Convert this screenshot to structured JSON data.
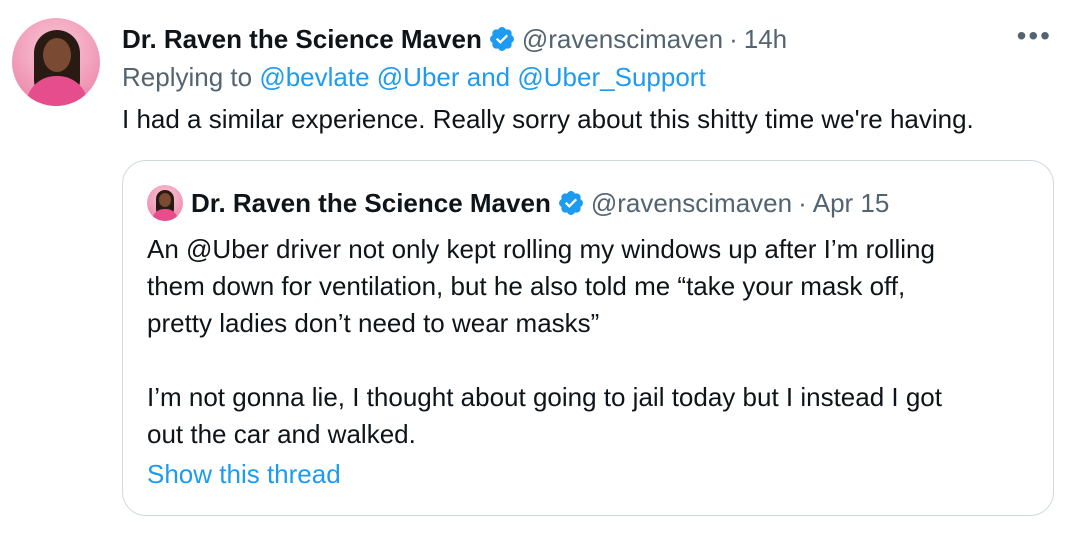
{
  "tweet": {
    "display_name": "Dr. Raven the Science Maven",
    "handle": "@ravenscimaven",
    "separator": "·",
    "time": "14h",
    "more_label": "•••",
    "replying_prefix": "Replying to",
    "replying_user1": "@bevlate",
    "replying_user2": "@Uber",
    "replying_and": "and",
    "replying_user3": "@Uber_Support",
    "text": "I had a similar experience. Really sorry about this shitty time we're having."
  },
  "quote": {
    "display_name": "Dr. Raven the Science Maven",
    "handle": "@ravenscimaven",
    "separator": "·",
    "date": "Apr 15",
    "line1": "An @Uber driver not only kept rolling my windows up after I’m rolling",
    "line2": "them down for ventilation, but he also told me “take your mask off,",
    "line3": "pretty ladies don’t need to wear masks”",
    "line4": "I’m not gonna lie, I thought about going to jail today but I instead I got",
    "line5": "out the car and walked.",
    "show_thread": "Show this thread"
  },
  "colors": {
    "link": "#1d9bf0",
    "muted": "#536471",
    "text": "#0f1419",
    "border": "#cfd9de",
    "verified": "#1d9bf0"
  },
  "icons": {
    "verified": "verified-badge-icon",
    "more": "more-options-icon"
  }
}
